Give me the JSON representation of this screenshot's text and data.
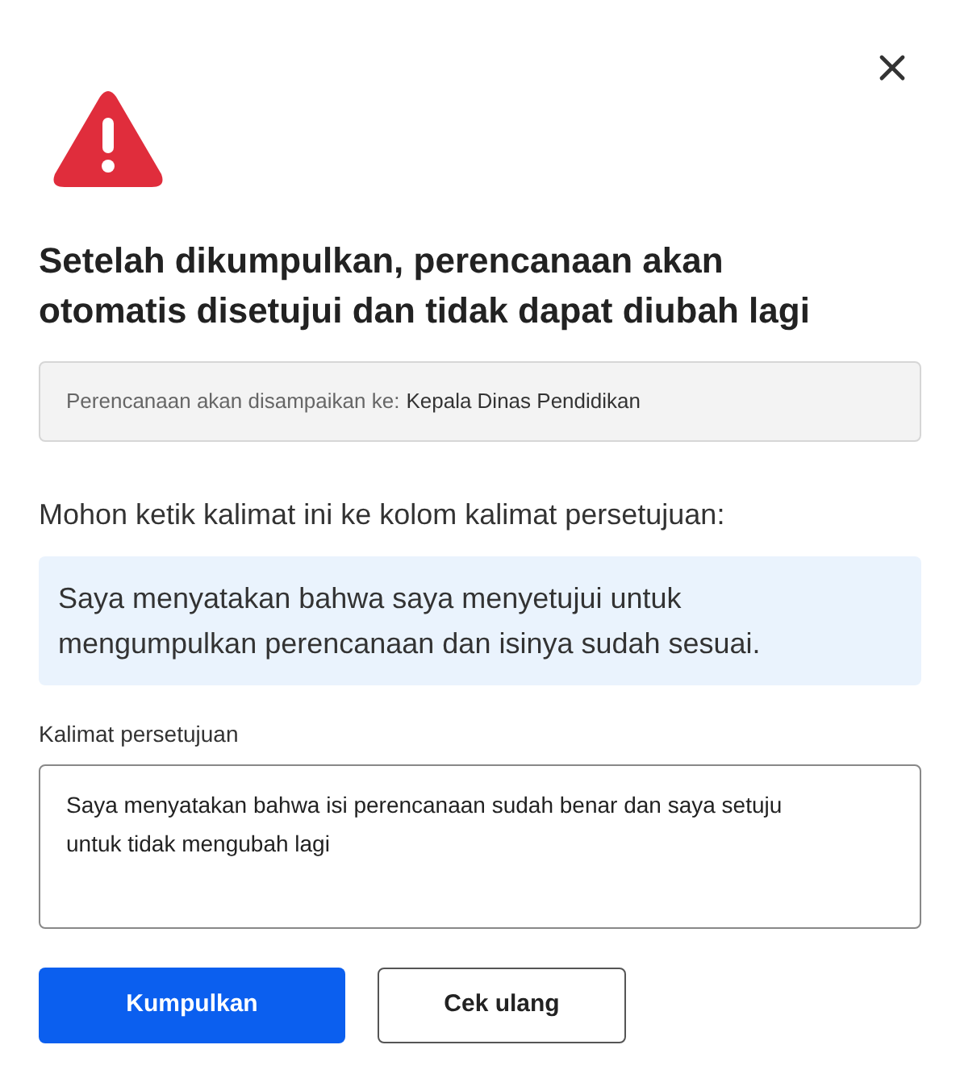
{
  "title": "Setelah dikumpulkan, perencanaan akan otomatis disetujui dan tidak dapat diubah lagi",
  "recipient": {
    "label": "Perencanaan akan disampaikan ke:",
    "value": "Kepala Dinas Pendidikan"
  },
  "instruction": "Mohon ketik kalimat ini ke kolom kalimat persetujuan:",
  "sentence": "Saya menyatakan bahwa saya menyetujui untuk mengumpulkan perencanaan dan isinya sudah sesuai.",
  "field": {
    "label": "Kalimat persetujuan",
    "value": "Saya menyatakan bahwa isi perencanaan sudah benar dan saya setuju untuk tidak mengubah lagi"
  },
  "buttons": [
    {
      "label": "Kumpulkan",
      "kind": "primary"
    },
    {
      "label": "Cek ulang",
      "kind": "secondary"
    }
  ]
}
